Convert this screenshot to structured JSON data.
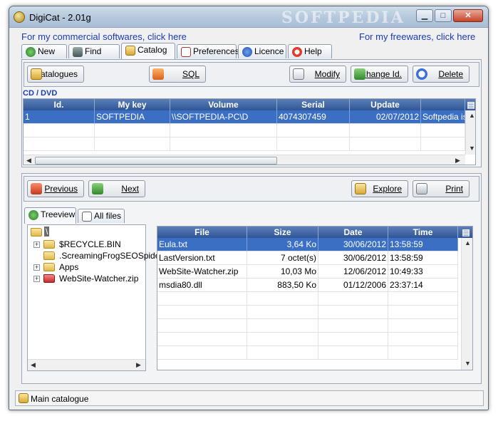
{
  "window": {
    "title": "DigiCat - 2.01g",
    "watermark": "SOFTPEDIA",
    "controls": {
      "minimize": "▁",
      "maximize": "□",
      "close": "✕"
    }
  },
  "links": {
    "commercial": "For my commercial softwares, click here",
    "freeware": "For my freewares, click here"
  },
  "tabs": [
    {
      "label": "New",
      "icon": "globe-icon"
    },
    {
      "label": "Find",
      "icon": "binoculars-icon"
    },
    {
      "label": "Catalog",
      "icon": "catalog-icon",
      "active": true
    },
    {
      "label": "Preferences",
      "icon": "checklist-icon"
    },
    {
      "label": "Licence",
      "icon": "info-icon"
    },
    {
      "label": "Help",
      "icon": "lifebuoy-icon"
    }
  ],
  "toolbar": {
    "catalogues": "Catalogues",
    "sql": "SQL",
    "modify": "Modify",
    "change_id": "Change Id.",
    "delete": "Delete"
  },
  "cd_dvd": {
    "section_label": "CD / DVD",
    "columns": [
      "Id.",
      "My key",
      "Volume",
      "Serial",
      "Update",
      ""
    ],
    "rows": [
      {
        "id": "1",
        "key": "SOFTPEDIA",
        "volume": "\\\\SOFTPEDIA-PC\\D",
        "serial": "4074307459",
        "update": "02/07/2012",
        "comment": "Softpedia is"
      }
    ]
  },
  "nav": {
    "previous": "Previous",
    "next": "Next",
    "explore": "Explore",
    "print": "Print"
  },
  "subtabs": [
    {
      "label": "Treeview",
      "icon": "tree-icon",
      "active": true
    },
    {
      "label": "All files",
      "icon": "files-icon"
    }
  ],
  "tree": {
    "root": "\\",
    "items": [
      "$RECYCLE.BIN",
      ".ScreamingFrogSEOSpide",
      "Apps",
      "WebSite-Watcher.zip"
    ]
  },
  "files": {
    "columns": [
      "File",
      "Size",
      "Date",
      "Time"
    ],
    "rows": [
      {
        "file": "Eula.txt",
        "size": "3,64 Ko",
        "date": "30/06/2012",
        "time": "13:58:59"
      },
      {
        "file": "LastVersion.txt",
        "size": "7 octet(s)",
        "date": "30/06/2012",
        "time": "13:58:59"
      },
      {
        "file": "WebSite-Watcher.zip",
        "size": "10,03 Mo",
        "date": "12/06/2012",
        "time": "10:49:33"
      },
      {
        "file": "msdia80.dll",
        "size": "883,50 Ko",
        "date": "01/12/2006",
        "time": "23:37:14"
      }
    ]
  },
  "status": {
    "text": "Main catalogue"
  }
}
